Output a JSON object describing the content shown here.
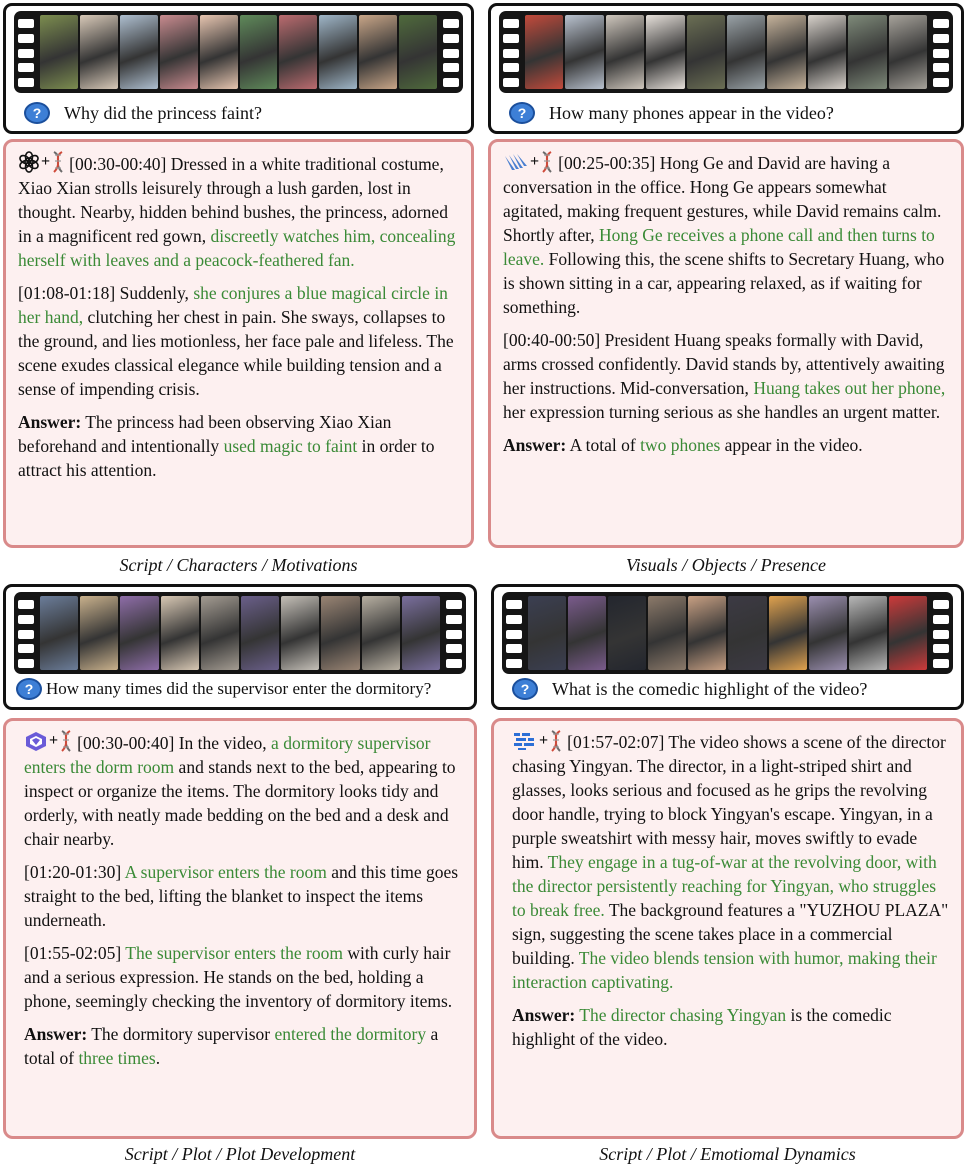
{
  "panels": [
    {
      "question": "Why did the princess faint?",
      "model_icon": "openai-logo-icon",
      "paragraphs": [
        [
          {
            "t": "[00:30-00:40] Dressed in a white traditional costume, Xiao Xian strolls leisurely through a lush garden, lost in thought. Nearby, hidden behind bushes, the princess, adorned in a magnificent red gown, "
          },
          {
            "t": "discreetly watches him, concealing herself with leaves and a peacock-feathered fan.",
            "h": true
          }
        ],
        [
          {
            "t": "[01:08-01:18] Suddenly, "
          },
          {
            "t": "she conjures a blue magical circle in her hand,",
            "h": true
          },
          {
            "t": " clutching her chest in pain. She sways, collapses to the ground, and lies motionless, her face pale and lifeless. The scene exudes classical elegance while building tension and a sense of impending crisis."
          }
        ]
      ],
      "answer_label": "Answer:",
      "answer": [
        {
          "t": " The princess had been observing Xiao Xian beforehand and intentionally "
        },
        {
          "t": "used magic to faint",
          "h": true
        },
        {
          "t": " in order to attract his attention."
        }
      ],
      "caption": "Script / Characters / Motivations"
    },
    {
      "question": "How many phones appear in the video?",
      "model_icon": "gemini-logo-icon",
      "paragraphs": [
        [
          {
            "t": "[00:25-00:35] Hong Ge and David are having a conversation in the office. Hong Ge appears somewhat agitated, making frequent gestures, while David remains calm. Shortly after, "
          },
          {
            "t": "Hong Ge receives a phone call and then turns to leave.",
            "h": true
          },
          {
            "t": " Following this, the scene shifts to Secretary Huang, who is shown sitting in a car, appearing relaxed, as if waiting for something."
          }
        ],
        [
          {
            "t": "[00:40-00:50] President Huang speaks formally with David, arms crossed confidently. David stands by, attentively awaiting her instructions. Mid-conversation, "
          },
          {
            "t": "Huang takes out her phone,",
            "h": true
          },
          {
            "t": " her expression turning serious as she handles an urgent matter."
          }
        ]
      ],
      "answer_label": "Answer:",
      "answer": [
        {
          "t": " A total of "
        },
        {
          "t": "two phones",
          "h": true
        },
        {
          "t": " appear in the video."
        }
      ],
      "caption": "Visuals / Objects / Presence"
    },
    {
      "question": "How many times did the supervisor enter the dormitory?",
      "model_icon": "qwen-logo-icon",
      "paragraphs": [
        [
          {
            "t": "[00:30-00:40] In the video, "
          },
          {
            "t": "a dormitory supervisor enters the dorm room",
            "h": true
          },
          {
            "t": " and stands next to the bed, appearing to inspect or organize the items. The dormitory looks tidy and orderly, with neatly made bedding on the bed and a desk and chair nearby."
          }
        ],
        [
          {
            "t": "[01:20-01:30] "
          },
          {
            "t": "A supervisor enters the room",
            "h": true
          },
          {
            "t": " and this time goes straight to the bed, lifting the blanket to inspect the items underneath."
          }
        ],
        [
          {
            "t": "[01:55-02:05] "
          },
          {
            "t": "The supervisor enters the room",
            "h": true
          },
          {
            "t": " with curly hair and a serious expression. He stands on the bed, holding a phone, seemingly checking the inventory of dormitory items."
          }
        ]
      ],
      "answer_label": "Answer:",
      "answer": [
        {
          "t": " The dormitory supervisor "
        },
        {
          "t": "entered the dormitory",
          "h": true
        },
        {
          "t": " a total of "
        },
        {
          "t": "three times",
          "h": true
        },
        {
          "t": "."
        }
      ],
      "caption": "Script / Plot / Plot Development"
    },
    {
      "question": "What is the comedic highlight of the video?",
      "model_icon": "llama-logo-icon",
      "paragraphs": [
        [
          {
            "t": "[01:57-02:07] The video shows a scene of the director chasing Yingyan. The director, in a light-striped shirt and glasses, looks serious and focused as he grips the revolving door handle, trying to block Yingyan's escape. Yingyan, in a purple sweatshirt with messy hair, moves swiftly to evade him. "
          },
          {
            "t": "They engage in a tug-of-war at the revolving door, with the director persistently reaching for Yingyan, who struggles to break free.",
            "h": true
          },
          {
            "t": " The background features a \"YUZHOU PLAZA\" sign, suggesting the scene takes place in a commercial building. "
          },
          {
            "t": "The video blends tension with humor, making their interaction captivating.",
            "h": true
          }
        ]
      ],
      "answer_label": "Answer:",
      "answer": [
        {
          "t": " "
        },
        {
          "t": "The director chasing Yingyan",
          "h": true
        },
        {
          "t": " is the comedic highlight of the video."
        }
      ],
      "caption": "Script / Plot / Emotiomal Dynamics"
    }
  ],
  "colors": {
    "highlight": "#3a8a36",
    "answer_border": "#d98a8a",
    "answer_bg": "#fdf0f0",
    "question_icon": "#3d7fd6"
  },
  "film_frames": [
    [
      "#7c8d4f",
      "#d8c9b8",
      "#aebfd0",
      "#c98b8f",
      "#e7c5b0",
      "#5f8a5a",
      "#bb6b6f",
      "#9fb6c8",
      "#c9a688",
      "#4f6a3c"
    ],
    [
      "#c34a3b",
      "#b9c2cf",
      "#cfc7bd",
      "#e6e0da",
      "#6b6f54",
      "#9aa3a8",
      "#c7b49c",
      "#d8d2cb",
      "#7f8b7a",
      "#a7a39b"
    ],
    [
      "#6b7d9a",
      "#c9b18c",
      "#8e6da8",
      "#d8c8b4",
      "#a49c92",
      "#6a5f8a",
      "#c5c0b8",
      "#9a8574",
      "#b8b0a2",
      "#7a6f9e"
    ],
    [
      "#3b3f52",
      "#7a5b8c",
      "#23262e",
      "#8c7a6a",
      "#c8a083",
      "#3c3a44",
      "#e0a24e",
      "#9b8fb0",
      "#b8b8b8",
      "#cc3a3a"
    ]
  ]
}
